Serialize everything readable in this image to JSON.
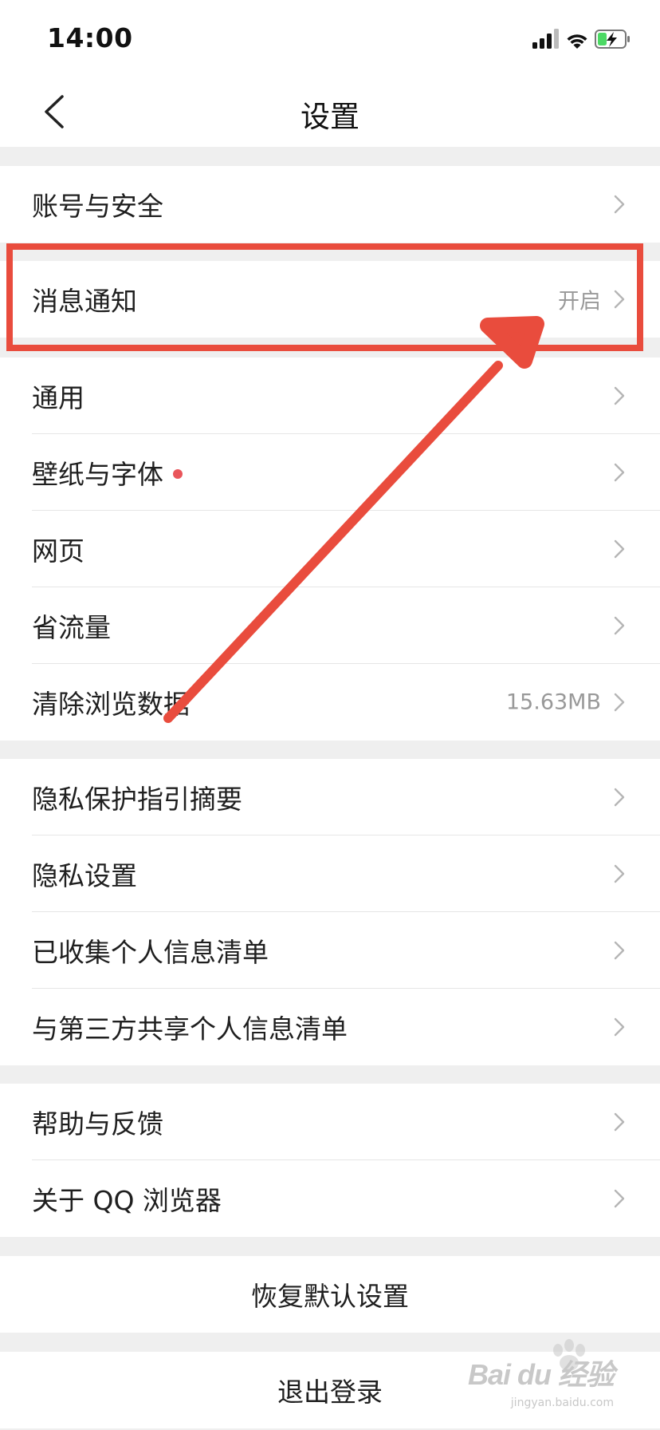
{
  "status_bar": {
    "time": "14:00",
    "icons": [
      "signal-icon",
      "wifi-icon",
      "battery-charging-icon"
    ],
    "battery_color": "#4cd964"
  },
  "header": {
    "title": "设置",
    "back_icon": "chevron-left-icon"
  },
  "groups": [
    {
      "items": [
        {
          "label": "账号与安全"
        }
      ]
    },
    {
      "items": [
        {
          "label": "消息通知",
          "value": "开启"
        }
      ]
    },
    {
      "items": [
        {
          "label": "通用"
        },
        {
          "label": "壁纸与字体",
          "badge_color": "#e9555a"
        },
        {
          "label": "网页"
        },
        {
          "label": "省流量"
        },
        {
          "label": "清除浏览数据",
          "value": "15.63MB"
        }
      ]
    },
    {
      "items": [
        {
          "label": "隐私保护指引摘要"
        },
        {
          "label": "隐私设置"
        },
        {
          "label": "已收集个人信息清单"
        },
        {
          "label": "与第三方共享个人信息清单"
        }
      ]
    },
    {
      "items": [
        {
          "label": "帮助与反馈"
        },
        {
          "label": "关于 QQ 浏览器"
        }
      ]
    }
  ],
  "actions": {
    "restore_label": "恢复默认设置",
    "logout_label": "退出登录"
  },
  "annotation": {
    "color": "#e94c3d",
    "target": "消息通知"
  },
  "watermark": {
    "brand": "Bai du",
    "sub_brand": "经验",
    "domain": "jingyan.baidu.com"
  }
}
